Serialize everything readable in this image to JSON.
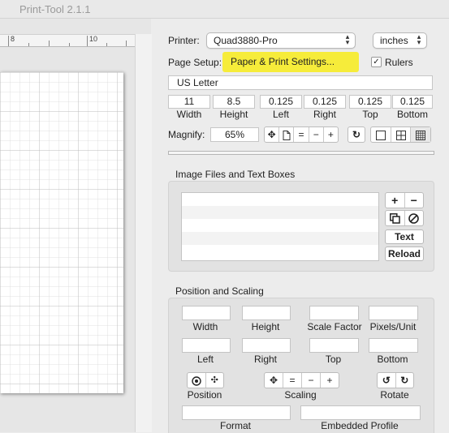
{
  "window": {
    "title": "Print-Tool 2.1.1"
  },
  "ruler": {
    "labels": [
      "8",
      "10"
    ]
  },
  "printer": {
    "label": "Printer:",
    "value": "Quad3880-Pro"
  },
  "units": {
    "value": "inches"
  },
  "page_setup": {
    "label": "Page Setup:",
    "button": "Paper & Print Settings...",
    "rulers_label": "Rulers",
    "rulers_checked": true
  },
  "paper_name": "US Letter",
  "dimensions": [
    {
      "label": "Width",
      "value": "11"
    },
    {
      "label": "Height",
      "value": "8.5"
    },
    {
      "label": "Left",
      "value": "0.125"
    },
    {
      "label": "Right",
      "value": "0.125"
    },
    {
      "label": "Top",
      "value": "0.125"
    },
    {
      "label": "Bottom",
      "value": "0.125"
    }
  ],
  "magnify": {
    "label": "Magnify:",
    "value": "65%"
  },
  "magnify_tools": [
    "move-icon",
    "page-icon",
    "=",
    "−",
    "+"
  ],
  "rotate_icon": "rotate-icon",
  "view_modes": [
    "single-page-icon",
    "four-grid-icon",
    "fine-grid-icon"
  ],
  "image_files": {
    "title": "Image Files and Text Boxes",
    "add": "+",
    "remove": "−",
    "text_button": "Text",
    "reload_button": "Reload"
  },
  "position_scaling": {
    "title": "Position and Scaling",
    "fields_row1": [
      "Width",
      "Height",
      "Scale Factor",
      "Pixels/Unit"
    ],
    "fields_row2": [
      "Left",
      "Right",
      "Top",
      "Bottom"
    ],
    "position_label": "Position",
    "scaling_label": "Scaling",
    "scaling_buttons": [
      "move-icon",
      "=",
      "−",
      "+"
    ],
    "rotate_label": "Rotate",
    "format_label": "Format",
    "profile_label": "Embedded Profile"
  }
}
